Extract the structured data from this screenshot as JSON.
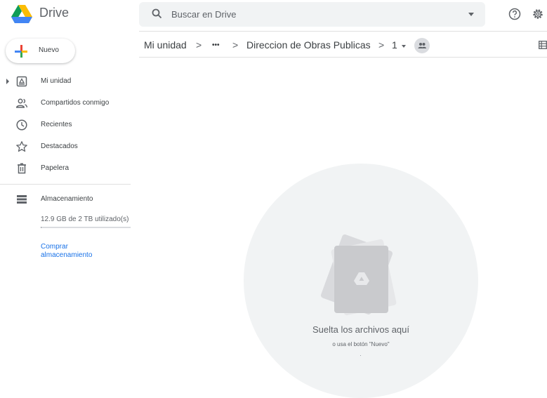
{
  "app": {
    "name": "Drive"
  },
  "search": {
    "placeholder": "Buscar en Drive"
  },
  "new_button": {
    "label": "Nuevo"
  },
  "sidebar": {
    "items": [
      {
        "label": "Mi unidad",
        "icon": "my-drive-icon"
      },
      {
        "label": "Compartidos conmigo",
        "icon": "shared-people-icon"
      },
      {
        "label": "Recientes",
        "icon": "clock-icon"
      },
      {
        "label": "Destacados",
        "icon": "star-icon"
      },
      {
        "label": "Papelera",
        "icon": "trash-icon"
      }
    ],
    "storage": {
      "label": "Almacenamiento",
      "usage_text": "12.9 GB de 2 TB utilizado(s)",
      "used_fraction": 0.006,
      "buy_label": "Comprar almacenamiento"
    }
  },
  "breadcrumb": {
    "items": [
      "Mi unidad",
      "•••",
      "Direccion de Obras Publicas",
      "1"
    ],
    "separator": ">"
  },
  "dropzone": {
    "title": "Suelta los archivos aquí",
    "subtitle": "o usa el botón \"Nuevo\""
  },
  "colors": {
    "accent": "#1a73e8",
    "surface": "#f1f3f4"
  }
}
